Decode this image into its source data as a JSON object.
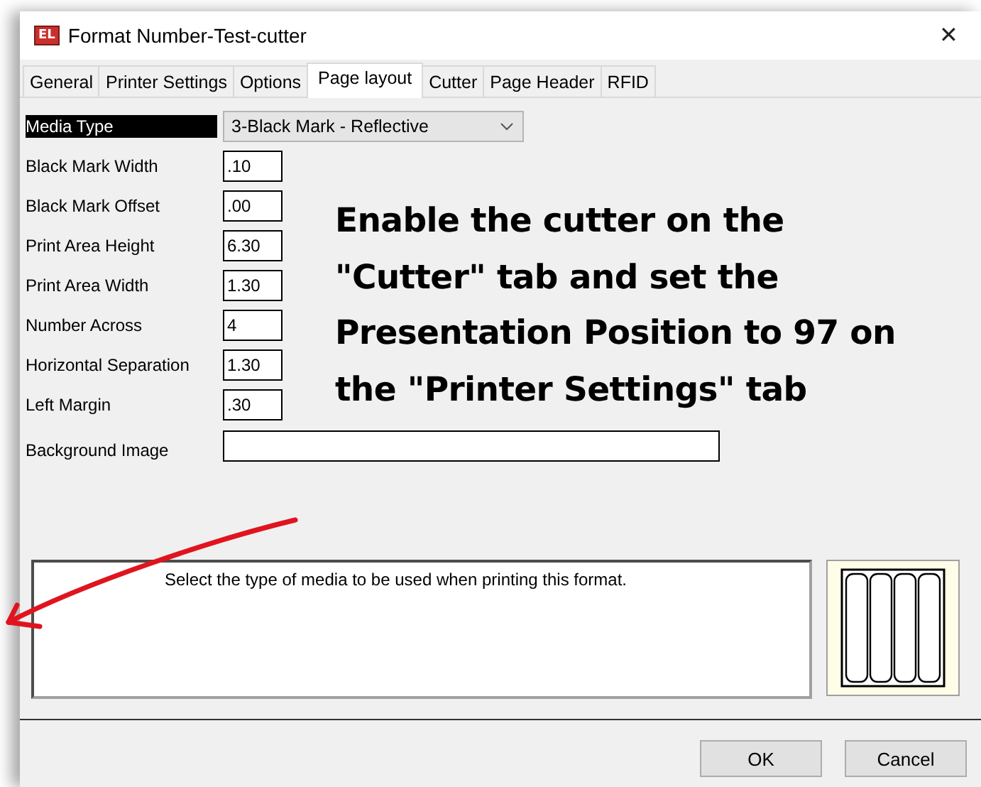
{
  "window": {
    "logo": "EL",
    "title": "Format Number-Test-cutter",
    "close": "✕"
  },
  "tabs": [
    {
      "label": "General",
      "selected": false
    },
    {
      "label": "Printer Settings",
      "selected": false
    },
    {
      "label": "Options",
      "selected": false
    },
    {
      "label": "Page layout",
      "selected": true
    },
    {
      "label": "Cutter",
      "selected": false
    },
    {
      "label": "Page Header",
      "selected": false
    },
    {
      "label": "RFID",
      "selected": false
    }
  ],
  "fields": [
    {
      "label": "Media Type",
      "kind": "dropdown",
      "value": "3-Black Mark - Reflective",
      "selected": true
    },
    {
      "label": "Black Mark Width",
      "kind": "text",
      "value": ".10",
      "selected": false
    },
    {
      "label": "Black Mark Offset",
      "kind": "text",
      "value": ".00",
      "selected": false
    },
    {
      "label": "Print Area Height",
      "kind": "text",
      "value": "6.30",
      "selected": false
    },
    {
      "label": "Print Area Width",
      "kind": "text",
      "value": "1.30",
      "selected": false
    },
    {
      "label": "Number Across",
      "kind": "text",
      "value": "4",
      "selected": false
    },
    {
      "label": "Horizontal Separation",
      "kind": "text",
      "value": "1.30",
      "selected": false
    },
    {
      "label": "Left Margin",
      "kind": "text",
      "value": ".30",
      "selected": false
    },
    {
      "label": "Background Image",
      "kind": "wide",
      "selected": false
    }
  ],
  "annotation": "Enable the cutter on the \"Cutter\" tab and set the Presentation Position to 97 on the \"Printer Settings\" tab",
  "description": "Select the type of media to be used when printing this format.",
  "buttons": [
    "OK",
    "Cancel"
  ]
}
